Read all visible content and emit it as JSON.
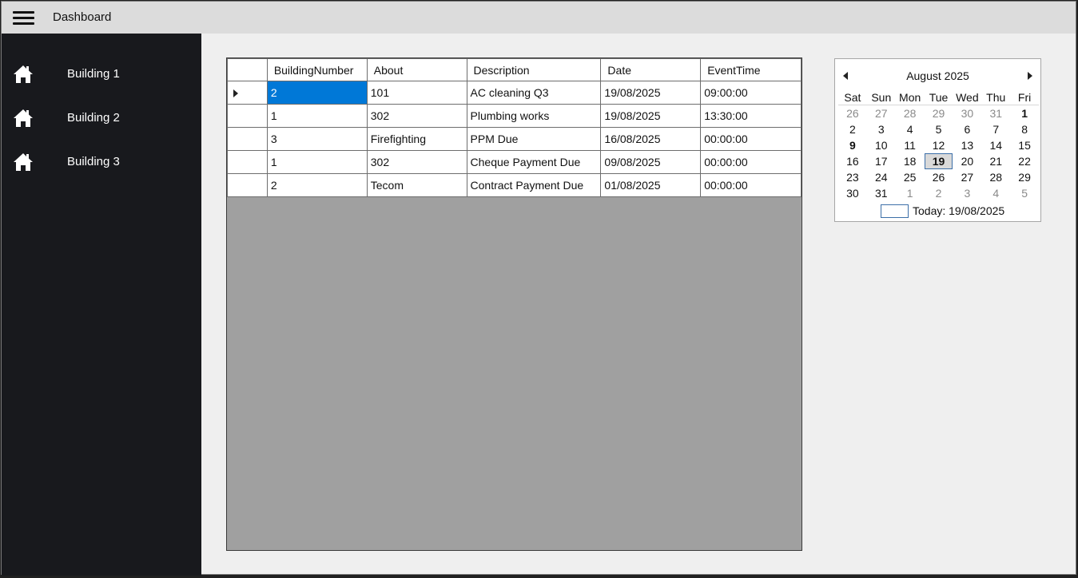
{
  "app": {
    "title": "Dashboard"
  },
  "sidebar": {
    "items": [
      {
        "label": "Building 1",
        "icon": "home-icon"
      },
      {
        "label": "Building 2",
        "icon": "home-icon"
      },
      {
        "label": "Building 3",
        "icon": "home-icon"
      }
    ]
  },
  "table": {
    "columns": [
      "BuildingNumber",
      "About",
      "Description",
      "Date",
      "EventTime"
    ],
    "rows": [
      [
        "2",
        "101",
        "AC cleaning Q3",
        "19/08/2025",
        "09:00:00"
      ],
      [
        "1",
        "302",
        "Plumbing works",
        "19/08/2025",
        "13:30:00"
      ],
      [
        "3",
        "Firefighting",
        "PPM Due",
        "16/08/2025",
        "00:00:00"
      ],
      [
        "1",
        "302",
        "Cheque Payment Due",
        "09/08/2025",
        "00:00:00"
      ],
      [
        "2",
        "Tecom",
        "Contract Payment Due",
        "01/08/2025",
        "00:00:00"
      ]
    ],
    "selected_row": 0,
    "selected_color": "#0078d7"
  },
  "calendar": {
    "month_label": "August 2025",
    "days_of_week": [
      "Sat",
      "Sun",
      "Mon",
      "Tue",
      "Wed",
      "Thu",
      "Fri"
    ],
    "weeks": [
      [
        "26",
        "27",
        "28",
        "29",
        "30",
        "31",
        "1"
      ],
      [
        "2",
        "3",
        "4",
        "5",
        "6",
        "7",
        "8"
      ],
      [
        "9",
        "10",
        "11",
        "12",
        "13",
        "14",
        "15"
      ],
      [
        "16",
        "17",
        "18",
        "19",
        "20",
        "21",
        "22"
      ],
      [
        "23",
        "24",
        "25",
        "26",
        "27",
        "28",
        "29"
      ],
      [
        "30",
        "31",
        "1",
        "2",
        "3",
        "4",
        "5"
      ]
    ],
    "other_month": [
      [
        true,
        true,
        true,
        true,
        true,
        true,
        false
      ],
      [
        false,
        false,
        false,
        false,
        false,
        false,
        false
      ],
      [
        false,
        false,
        false,
        false,
        false,
        false,
        false
      ],
      [
        false,
        false,
        false,
        false,
        false,
        false,
        false
      ],
      [
        false,
        false,
        false,
        false,
        false,
        false,
        false
      ],
      [
        false,
        false,
        true,
        true,
        true,
        true,
        true
      ]
    ],
    "bold_days": [
      "1",
      "9"
    ],
    "today_day": "19",
    "today_label": "Today: 19/08/2025"
  },
  "colors": {
    "sidebar_bg": "#18191d",
    "topbar_bg": "#dcdcdc",
    "grid_empty_bg": "#a0a0a0"
  }
}
